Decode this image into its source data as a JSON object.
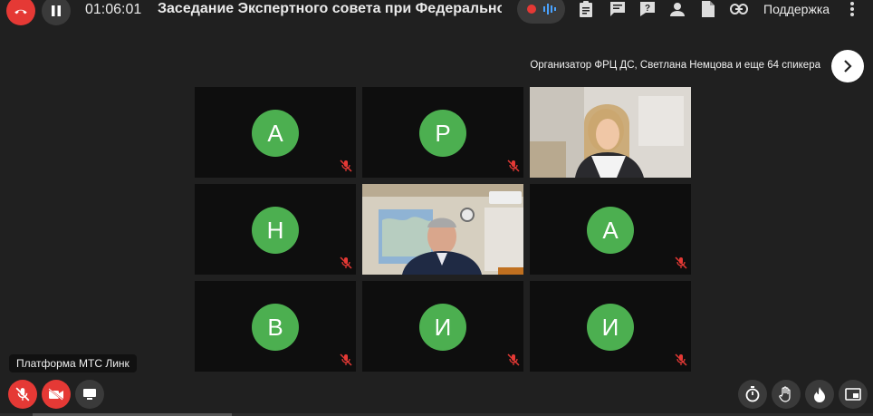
{
  "header": {
    "timer": "01:06:01",
    "meeting_title": "Заседание Экспертного совета при Федеральном р",
    "support_label": "Поддержка"
  },
  "speakers_bar": {
    "organizer_text": "Организатор ФРЦ ДС, Светлана Немцова и еще 64 спикера"
  },
  "tiles": [
    {
      "initial": "А",
      "muted": true
    },
    {
      "initial": "Р",
      "muted": true
    },
    {
      "video": true,
      "muted": false
    },
    {
      "initial": "Н",
      "muted": true
    },
    {
      "video": true,
      "muted": false
    },
    {
      "initial": "А",
      "muted": true
    },
    {
      "initial": "В",
      "muted": true
    },
    {
      "initial": "И",
      "muted": true
    },
    {
      "initial": "И",
      "muted": true
    }
  ],
  "self_view": {
    "label": "Платформа МТС Линк"
  },
  "icons": {
    "end_call": "phone-hangup-icon",
    "pause": "pause-icon",
    "recording": "record-icon",
    "equalizer": "audio-level-icon",
    "notes": "clipboard-icon",
    "chat": "chat-icon",
    "questions": "question-icon",
    "participants": "person-icon",
    "files": "document-icon",
    "link": "link-icon",
    "more": "kebab-icon",
    "next": "chevron-right-icon",
    "mic_off": "mic-off-icon",
    "camera_off": "camera-off-icon",
    "screen_share": "monitor-icon",
    "timer": "stopwatch-icon",
    "raise_hand": "hand-icon",
    "reactions": "flame-icon",
    "pip": "picture-in-picture-icon"
  },
  "colors": {
    "background": "#202020",
    "tile": "#0e0e0e",
    "avatar": "#4caf50",
    "danger": "#e53935",
    "muted_icon": "#e53935"
  }
}
